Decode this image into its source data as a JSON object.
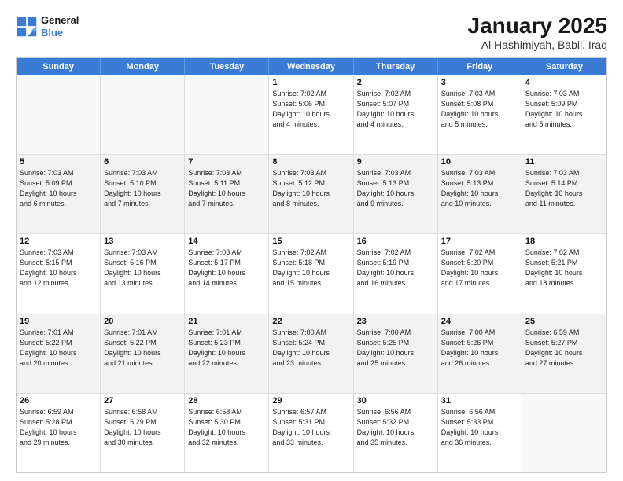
{
  "logo": {
    "line1": "General",
    "line2": "Blue"
  },
  "title": "January 2025",
  "subtitle": "Al Hashimiyah, Babil, Iraq",
  "weekdays": [
    "Sunday",
    "Monday",
    "Tuesday",
    "Wednesday",
    "Thursday",
    "Friday",
    "Saturday"
  ],
  "rows": [
    [
      {
        "day": "",
        "text": "",
        "empty": true
      },
      {
        "day": "",
        "text": "",
        "empty": true
      },
      {
        "day": "",
        "text": "",
        "empty": true
      },
      {
        "day": "1",
        "text": "Sunrise: 7:02 AM\nSunset: 5:06 PM\nDaylight: 10 hours\nand 4 minutes."
      },
      {
        "day": "2",
        "text": "Sunrise: 7:02 AM\nSunset: 5:07 PM\nDaylight: 10 hours\nand 4 minutes."
      },
      {
        "day": "3",
        "text": "Sunrise: 7:03 AM\nSunset: 5:08 PM\nDaylight: 10 hours\nand 5 minutes."
      },
      {
        "day": "4",
        "text": "Sunrise: 7:03 AM\nSunset: 5:09 PM\nDaylight: 10 hours\nand 5 minutes."
      }
    ],
    [
      {
        "day": "5",
        "text": "Sunrise: 7:03 AM\nSunset: 5:09 PM\nDaylight: 10 hours\nand 6 minutes."
      },
      {
        "day": "6",
        "text": "Sunrise: 7:03 AM\nSunset: 5:10 PM\nDaylight: 10 hours\nand 7 minutes."
      },
      {
        "day": "7",
        "text": "Sunrise: 7:03 AM\nSunset: 5:11 PM\nDaylight: 10 hours\nand 7 minutes."
      },
      {
        "day": "8",
        "text": "Sunrise: 7:03 AM\nSunset: 5:12 PM\nDaylight: 10 hours\nand 8 minutes."
      },
      {
        "day": "9",
        "text": "Sunrise: 7:03 AM\nSunset: 5:13 PM\nDaylight: 10 hours\nand 9 minutes."
      },
      {
        "day": "10",
        "text": "Sunrise: 7:03 AM\nSunset: 5:13 PM\nDaylight: 10 hours\nand 10 minutes."
      },
      {
        "day": "11",
        "text": "Sunrise: 7:03 AM\nSunset: 5:14 PM\nDaylight: 10 hours\nand 11 minutes."
      }
    ],
    [
      {
        "day": "12",
        "text": "Sunrise: 7:03 AM\nSunset: 5:15 PM\nDaylight: 10 hours\nand 12 minutes."
      },
      {
        "day": "13",
        "text": "Sunrise: 7:03 AM\nSunset: 5:16 PM\nDaylight: 10 hours\nand 13 minutes."
      },
      {
        "day": "14",
        "text": "Sunrise: 7:03 AM\nSunset: 5:17 PM\nDaylight: 10 hours\nand 14 minutes."
      },
      {
        "day": "15",
        "text": "Sunrise: 7:02 AM\nSunset: 5:18 PM\nDaylight: 10 hours\nand 15 minutes."
      },
      {
        "day": "16",
        "text": "Sunrise: 7:02 AM\nSunset: 5:19 PM\nDaylight: 10 hours\nand 16 minutes."
      },
      {
        "day": "17",
        "text": "Sunrise: 7:02 AM\nSunset: 5:20 PM\nDaylight: 10 hours\nand 17 minutes."
      },
      {
        "day": "18",
        "text": "Sunrise: 7:02 AM\nSunset: 5:21 PM\nDaylight: 10 hours\nand 18 minutes."
      }
    ],
    [
      {
        "day": "19",
        "text": "Sunrise: 7:01 AM\nSunset: 5:22 PM\nDaylight: 10 hours\nand 20 minutes."
      },
      {
        "day": "20",
        "text": "Sunrise: 7:01 AM\nSunset: 5:22 PM\nDaylight: 10 hours\nand 21 minutes."
      },
      {
        "day": "21",
        "text": "Sunrise: 7:01 AM\nSunset: 5:23 PM\nDaylight: 10 hours\nand 22 minutes."
      },
      {
        "day": "22",
        "text": "Sunrise: 7:00 AM\nSunset: 5:24 PM\nDaylight: 10 hours\nand 23 minutes."
      },
      {
        "day": "23",
        "text": "Sunrise: 7:00 AM\nSunset: 5:25 PM\nDaylight: 10 hours\nand 25 minutes."
      },
      {
        "day": "24",
        "text": "Sunrise: 7:00 AM\nSunset: 5:26 PM\nDaylight: 10 hours\nand 26 minutes."
      },
      {
        "day": "25",
        "text": "Sunrise: 6:59 AM\nSunset: 5:27 PM\nDaylight: 10 hours\nand 27 minutes."
      }
    ],
    [
      {
        "day": "26",
        "text": "Sunrise: 6:59 AM\nSunset: 5:28 PM\nDaylight: 10 hours\nand 29 minutes."
      },
      {
        "day": "27",
        "text": "Sunrise: 6:58 AM\nSunset: 5:29 PM\nDaylight: 10 hours\nand 30 minutes."
      },
      {
        "day": "28",
        "text": "Sunrise: 6:58 AM\nSunset: 5:30 PM\nDaylight: 10 hours\nand 32 minutes."
      },
      {
        "day": "29",
        "text": "Sunrise: 6:57 AM\nSunset: 5:31 PM\nDaylight: 10 hours\nand 33 minutes."
      },
      {
        "day": "30",
        "text": "Sunrise: 6:56 AM\nSunset: 5:32 PM\nDaylight: 10 hours\nand 35 minutes."
      },
      {
        "day": "31",
        "text": "Sunrise: 6:56 AM\nSunset: 5:33 PM\nDaylight: 10 hours\nand 36 minutes."
      },
      {
        "day": "",
        "text": "",
        "empty": true
      }
    ]
  ]
}
